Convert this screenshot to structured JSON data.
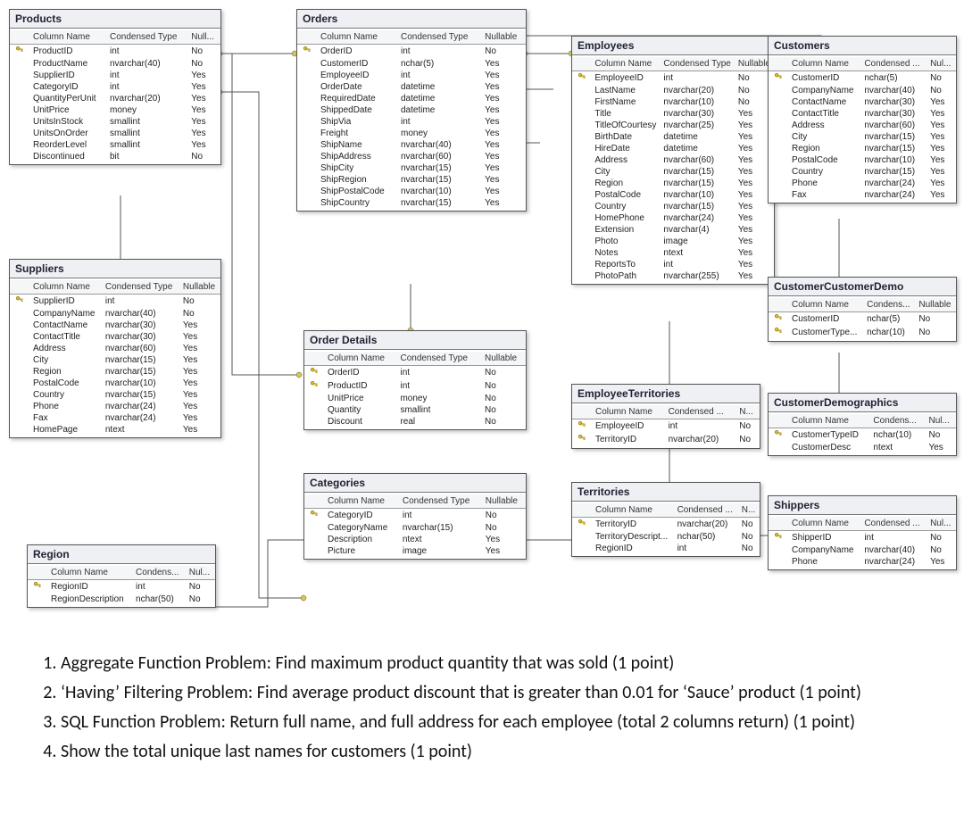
{
  "headers": {
    "col": "Column Name",
    "type": "Condensed Type",
    "type_short": "Condensed ...",
    "type_short2": "Condens...",
    "null": "Nullable",
    "null_short": "Null...",
    "null_short2": "Nul...",
    "null_short3": "N..."
  },
  "entities": {
    "products": {
      "title": "Products",
      "cols": [
        {
          "pk": true,
          "name": "ProductID",
          "type": "int",
          "null": "No"
        },
        {
          "pk": false,
          "name": "ProductName",
          "type": "nvarchar(40)",
          "null": "No"
        },
        {
          "pk": false,
          "name": "SupplierID",
          "type": "int",
          "null": "Yes"
        },
        {
          "pk": false,
          "name": "CategoryID",
          "type": "int",
          "null": "Yes"
        },
        {
          "pk": false,
          "name": "QuantityPerUnit",
          "type": "nvarchar(20)",
          "null": "Yes"
        },
        {
          "pk": false,
          "name": "UnitPrice",
          "type": "money",
          "null": "Yes"
        },
        {
          "pk": false,
          "name": "UnitsInStock",
          "type": "smallint",
          "null": "Yes"
        },
        {
          "pk": false,
          "name": "UnitsOnOrder",
          "type": "smallint",
          "null": "Yes"
        },
        {
          "pk": false,
          "name": "ReorderLevel",
          "type": "smallint",
          "null": "Yes"
        },
        {
          "pk": false,
          "name": "Discontinued",
          "type": "bit",
          "null": "No"
        }
      ]
    },
    "orders": {
      "title": "Orders",
      "cols": [
        {
          "pk": true,
          "name": "OrderID",
          "type": "int",
          "null": "No"
        },
        {
          "pk": false,
          "name": "CustomerID",
          "type": "nchar(5)",
          "null": "Yes"
        },
        {
          "pk": false,
          "name": "EmployeeID",
          "type": "int",
          "null": "Yes"
        },
        {
          "pk": false,
          "name": "OrderDate",
          "type": "datetime",
          "null": "Yes"
        },
        {
          "pk": false,
          "name": "RequiredDate",
          "type": "datetime",
          "null": "Yes"
        },
        {
          "pk": false,
          "name": "ShippedDate",
          "type": "datetime",
          "null": "Yes"
        },
        {
          "pk": false,
          "name": "ShipVia",
          "type": "int",
          "null": "Yes"
        },
        {
          "pk": false,
          "name": "Freight",
          "type": "money",
          "null": "Yes"
        },
        {
          "pk": false,
          "name": "ShipName",
          "type": "nvarchar(40)",
          "null": "Yes"
        },
        {
          "pk": false,
          "name": "ShipAddress",
          "type": "nvarchar(60)",
          "null": "Yes"
        },
        {
          "pk": false,
          "name": "ShipCity",
          "type": "nvarchar(15)",
          "null": "Yes"
        },
        {
          "pk": false,
          "name": "ShipRegion",
          "type": "nvarchar(15)",
          "null": "Yes"
        },
        {
          "pk": false,
          "name": "ShipPostalCode",
          "type": "nvarchar(10)",
          "null": "Yes"
        },
        {
          "pk": false,
          "name": "ShipCountry",
          "type": "nvarchar(15)",
          "null": "Yes"
        }
      ]
    },
    "employees": {
      "title": "Employees",
      "cols": [
        {
          "pk": true,
          "name": "EmployeeID",
          "type": "int",
          "null": "No"
        },
        {
          "pk": false,
          "name": "LastName",
          "type": "nvarchar(20)",
          "null": "No"
        },
        {
          "pk": false,
          "name": "FirstName",
          "type": "nvarchar(10)",
          "null": "No"
        },
        {
          "pk": false,
          "name": "Title",
          "type": "nvarchar(30)",
          "null": "Yes"
        },
        {
          "pk": false,
          "name": "TitleOfCourtesy",
          "type": "nvarchar(25)",
          "null": "Yes"
        },
        {
          "pk": false,
          "name": "BirthDate",
          "type": "datetime",
          "null": "Yes"
        },
        {
          "pk": false,
          "name": "HireDate",
          "type": "datetime",
          "null": "Yes"
        },
        {
          "pk": false,
          "name": "Address",
          "type": "nvarchar(60)",
          "null": "Yes"
        },
        {
          "pk": false,
          "name": "City",
          "type": "nvarchar(15)",
          "null": "Yes"
        },
        {
          "pk": false,
          "name": "Region",
          "type": "nvarchar(15)",
          "null": "Yes"
        },
        {
          "pk": false,
          "name": "PostalCode",
          "type": "nvarchar(10)",
          "null": "Yes"
        },
        {
          "pk": false,
          "name": "Country",
          "type": "nvarchar(15)",
          "null": "Yes"
        },
        {
          "pk": false,
          "name": "HomePhone",
          "type": "nvarchar(24)",
          "null": "Yes"
        },
        {
          "pk": false,
          "name": "Extension",
          "type": "nvarchar(4)",
          "null": "Yes"
        },
        {
          "pk": false,
          "name": "Photo",
          "type": "image",
          "null": "Yes"
        },
        {
          "pk": false,
          "name": "Notes",
          "type": "ntext",
          "null": "Yes"
        },
        {
          "pk": false,
          "name": "ReportsTo",
          "type": "int",
          "null": "Yes"
        },
        {
          "pk": false,
          "name": "PhotoPath",
          "type": "nvarchar(255)",
          "null": "Yes"
        }
      ]
    },
    "customers": {
      "title": "Customers",
      "cols": [
        {
          "pk": true,
          "name": "CustomerID",
          "type": "nchar(5)",
          "null": "No"
        },
        {
          "pk": false,
          "name": "CompanyName",
          "type": "nvarchar(40)",
          "null": "No"
        },
        {
          "pk": false,
          "name": "ContactName",
          "type": "nvarchar(30)",
          "null": "Yes"
        },
        {
          "pk": false,
          "name": "ContactTitle",
          "type": "nvarchar(30)",
          "null": "Yes"
        },
        {
          "pk": false,
          "name": "Address",
          "type": "nvarchar(60)",
          "null": "Yes"
        },
        {
          "pk": false,
          "name": "City",
          "type": "nvarchar(15)",
          "null": "Yes"
        },
        {
          "pk": false,
          "name": "Region",
          "type": "nvarchar(15)",
          "null": "Yes"
        },
        {
          "pk": false,
          "name": "PostalCode",
          "type": "nvarchar(10)",
          "null": "Yes"
        },
        {
          "pk": false,
          "name": "Country",
          "type": "nvarchar(15)",
          "null": "Yes"
        },
        {
          "pk": false,
          "name": "Phone",
          "type": "nvarchar(24)",
          "null": "Yes"
        },
        {
          "pk": false,
          "name": "Fax",
          "type": "nvarchar(24)",
          "null": "Yes"
        }
      ]
    },
    "suppliers": {
      "title": "Suppliers",
      "cols": [
        {
          "pk": true,
          "name": "SupplierID",
          "type": "int",
          "null": "No"
        },
        {
          "pk": false,
          "name": "CompanyName",
          "type": "nvarchar(40)",
          "null": "No"
        },
        {
          "pk": false,
          "name": "ContactName",
          "type": "nvarchar(30)",
          "null": "Yes"
        },
        {
          "pk": false,
          "name": "ContactTitle",
          "type": "nvarchar(30)",
          "null": "Yes"
        },
        {
          "pk": false,
          "name": "Address",
          "type": "nvarchar(60)",
          "null": "Yes"
        },
        {
          "pk": false,
          "name": "City",
          "type": "nvarchar(15)",
          "null": "Yes"
        },
        {
          "pk": false,
          "name": "Region",
          "type": "nvarchar(15)",
          "null": "Yes"
        },
        {
          "pk": false,
          "name": "PostalCode",
          "type": "nvarchar(10)",
          "null": "Yes"
        },
        {
          "pk": false,
          "name": "Country",
          "type": "nvarchar(15)",
          "null": "Yes"
        },
        {
          "pk": false,
          "name": "Phone",
          "type": "nvarchar(24)",
          "null": "Yes"
        },
        {
          "pk": false,
          "name": "Fax",
          "type": "nvarchar(24)",
          "null": "Yes"
        },
        {
          "pk": false,
          "name": "HomePage",
          "type": "ntext",
          "null": "Yes"
        }
      ]
    },
    "orderdetails": {
      "title": "Order Details",
      "cols": [
        {
          "pk": true,
          "name": "OrderID",
          "type": "int",
          "null": "No"
        },
        {
          "pk": true,
          "name": "ProductID",
          "type": "int",
          "null": "No"
        },
        {
          "pk": false,
          "name": "UnitPrice",
          "type": "money",
          "null": "No"
        },
        {
          "pk": false,
          "name": "Quantity",
          "type": "smallint",
          "null": "No"
        },
        {
          "pk": false,
          "name": "Discount",
          "type": "real",
          "null": "No"
        }
      ]
    },
    "categories": {
      "title": "Categories",
      "cols": [
        {
          "pk": true,
          "name": "CategoryID",
          "type": "int",
          "null": "No"
        },
        {
          "pk": false,
          "name": "CategoryName",
          "type": "nvarchar(15)",
          "null": "No"
        },
        {
          "pk": false,
          "name": "Description",
          "type": "ntext",
          "null": "Yes"
        },
        {
          "pk": false,
          "name": "Picture",
          "type": "image",
          "null": "Yes"
        }
      ]
    },
    "employeeterritories": {
      "title": "EmployeeTerritories",
      "cols": [
        {
          "pk": true,
          "name": "EmployeeID",
          "type": "int",
          "null": "No"
        },
        {
          "pk": true,
          "name": "TerritoryID",
          "type": "nvarchar(20)",
          "null": "No"
        }
      ]
    },
    "territories": {
      "title": "Territories",
      "cols": [
        {
          "pk": true,
          "name": "TerritoryID",
          "type": "nvarchar(20)",
          "null": "No"
        },
        {
          "pk": false,
          "name": "TerritoryDescript...",
          "type": "nchar(50)",
          "null": "No"
        },
        {
          "pk": false,
          "name": "RegionID",
          "type": "int",
          "null": "No"
        }
      ]
    },
    "region": {
      "title": "Region",
      "cols": [
        {
          "pk": true,
          "name": "RegionID",
          "type": "int",
          "null": "No"
        },
        {
          "pk": false,
          "name": "RegionDescription",
          "type": "nchar(50)",
          "null": "No"
        }
      ]
    },
    "customercustomerdemo": {
      "title": "CustomerCustomerDemo",
      "cols": [
        {
          "pk": true,
          "name": "CustomerID",
          "type": "nchar(5)",
          "null": "No"
        },
        {
          "pk": true,
          "name": "CustomerType...",
          "type": "nchar(10)",
          "null": "No"
        }
      ]
    },
    "customerdemographics": {
      "title": "CustomerDemographics",
      "cols": [
        {
          "pk": true,
          "name": "CustomerTypeID",
          "type": "nchar(10)",
          "null": "No"
        },
        {
          "pk": false,
          "name": "CustomerDesc",
          "type": "ntext",
          "null": "Yes"
        }
      ]
    },
    "shippers": {
      "title": "Shippers",
      "cols": [
        {
          "pk": true,
          "name": "ShipperID",
          "type": "int",
          "null": "No"
        },
        {
          "pk": false,
          "name": "CompanyName",
          "type": "nvarchar(40)",
          "null": "No"
        },
        {
          "pk": false,
          "name": "Phone",
          "type": "nvarchar(24)",
          "null": "Yes"
        }
      ]
    }
  },
  "questions": [
    "Aggregate Function Problem: Find maximum product quantity that was sold (1 point)",
    "‘Having’ Filtering Problem: Find average product discount that is greater than 0.01 for ‘Sauce’ product (1 point)",
    "SQL Function Problem: Return full name, and full address for each employee (total 2 columns return) (1 point)",
    "Show the total unique last names for customers (1 point)"
  ]
}
